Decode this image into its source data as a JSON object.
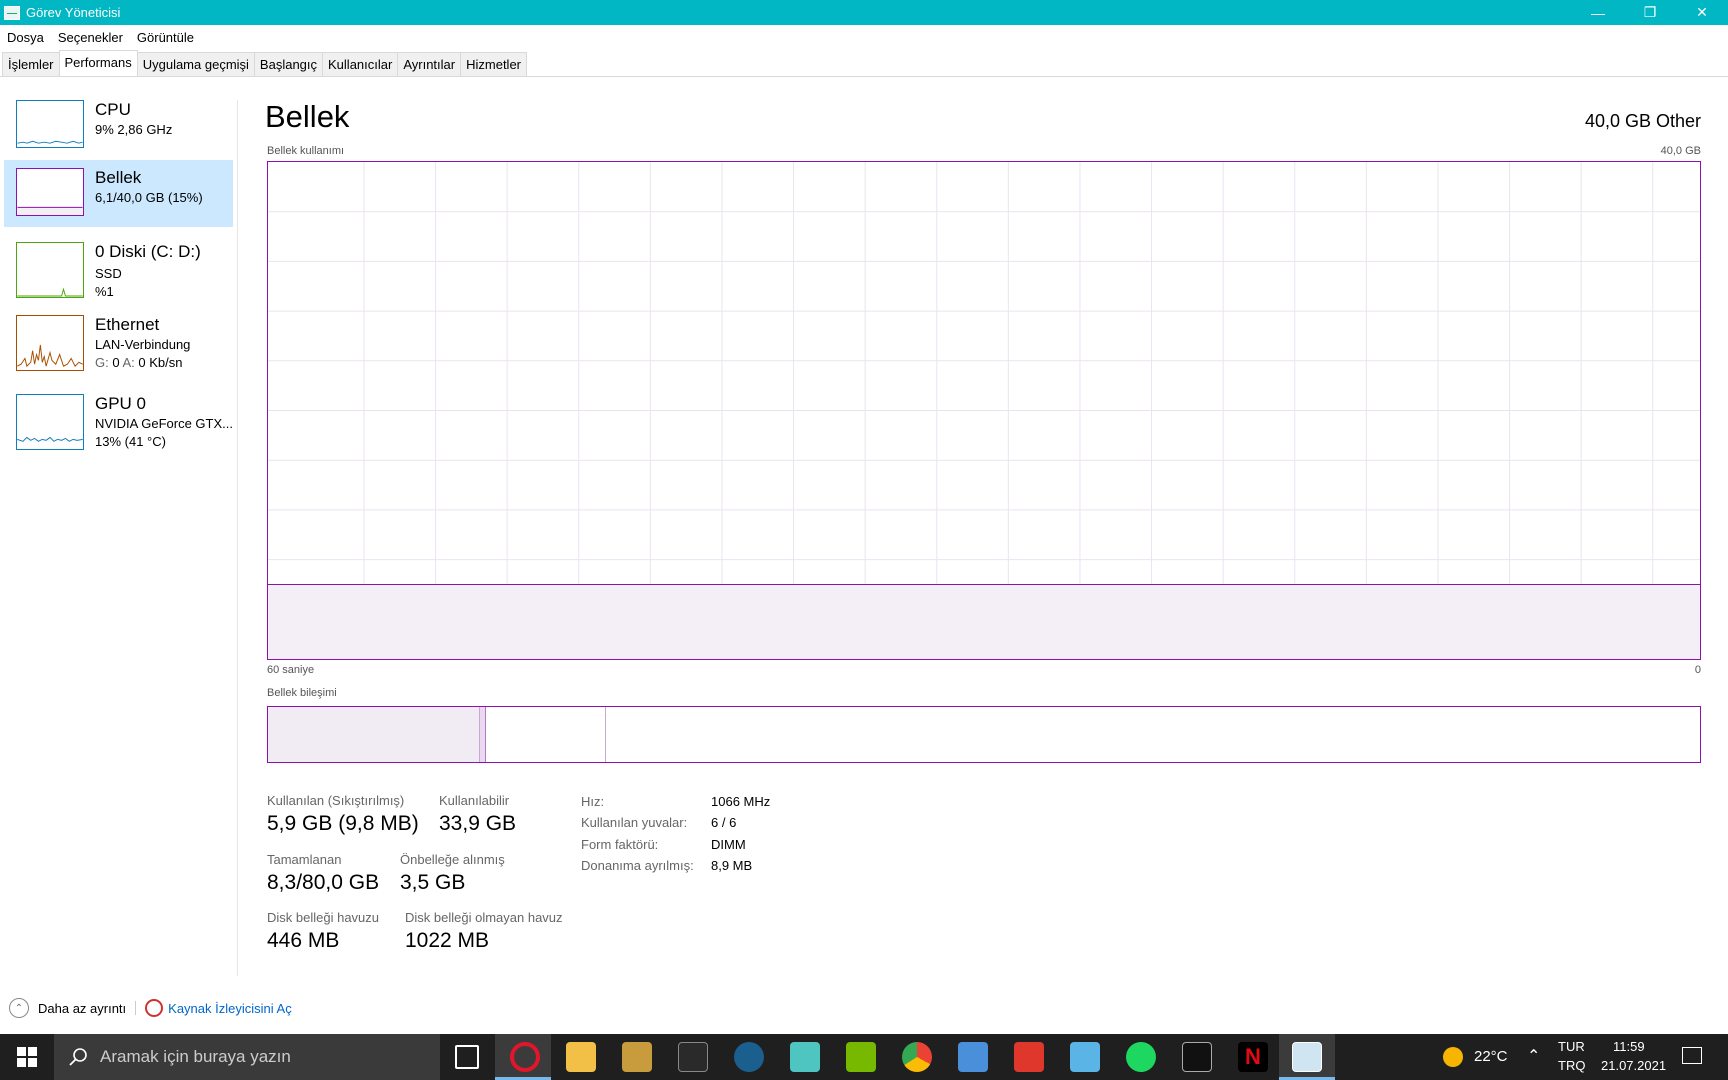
{
  "window": {
    "title": "Görev Yöneticisi"
  },
  "menu": [
    "Dosya",
    "Seçenekler",
    "Görüntüle"
  ],
  "tabs": [
    {
      "label": "İşlemler",
      "active": false
    },
    {
      "label": "Performans",
      "active": true
    },
    {
      "label": "Uygulama geçmişi",
      "active": false
    },
    {
      "label": "Başlangıç",
      "active": false
    },
    {
      "label": "Kullanıcılar",
      "active": false
    },
    {
      "label": "Ayrıntılar",
      "active": false
    },
    {
      "label": "Hizmetler",
      "active": false
    }
  ],
  "sidebar": {
    "items": [
      {
        "name": "CPU",
        "line1": "9%  2,86 GHz",
        "line2": "",
        "color": "#117dbb"
      },
      {
        "name": "Bellek",
        "line1": "6,1/40,0 GB (15%)",
        "line2": "",
        "color": "#8b12ae"
      },
      {
        "name": "0 Diski (C: D:)",
        "line1": "SSD",
        "line2": "%1",
        "color": "#4da60c"
      },
      {
        "name": "Ethernet",
        "line1": "LAN-Verbindung",
        "line2_label_g": "G:",
        "line2_val_g": "0",
        "line2_label_a": "A:",
        "line2_val_a": "0 Kb/sn",
        "color": "#a74f01"
      },
      {
        "name": "GPU 0",
        "line1": "NVIDIA GeForce GTX...",
        "line2": "13%  (41 °C)",
        "color": "#117dbb"
      }
    ]
  },
  "main": {
    "title": "Bellek",
    "capacity": "40,0 GB Other",
    "usage_label": "Bellek kullanımı",
    "usage_max": "40,0 GB",
    "time_left": "60 saniye",
    "time_right": "0",
    "composition_label": "Bellek bileşimi",
    "usage_fraction": 0.15,
    "composition": {
      "in_use": 0.148,
      "modified": 0.004,
      "standby": 0.084
    }
  },
  "stats": {
    "in_use_label": "Kullanılan (Sıkıştırılmış)",
    "in_use_value": "5,9 GB (9,8 MB)",
    "available_label": "Kullanılabilir",
    "available_value": "33,9 GB",
    "committed_label": "Tamamlanan",
    "committed_value": "8,3/80,0 GB",
    "cached_label": "Önbelleğe alınmış",
    "cached_value": "3,5 GB",
    "paged_label": "Disk belleği havuzu",
    "paged_value": "446 MB",
    "nonpaged_label": "Disk belleği olmayan havuz",
    "nonpaged_value": "1022 MB"
  },
  "hardware": {
    "speed_label": "Hız:",
    "speed_value": "1066 MHz",
    "slots_label": "Kullanılan yuvalar:",
    "slots_value": "6 / 6",
    "form_label": "Form faktörü:",
    "form_value": "DIMM",
    "reserved_label": "Donanıma ayrılmış:",
    "reserved_value": "8,9 MB"
  },
  "footer": {
    "fewer_details": "Daha az ayrıntı",
    "resource_monitor": "Kaynak İzleyicisini Aç"
  },
  "taskbar": {
    "search_placeholder": "Aramak için buraya yazın",
    "weather": "22°C",
    "lang_top": "TUR",
    "lang_bottom": "TRQ",
    "time": "11:59",
    "date": "21.07.2021"
  }
}
